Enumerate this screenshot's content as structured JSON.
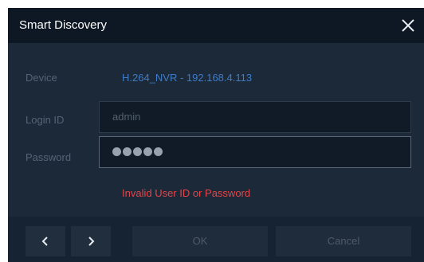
{
  "dialog": {
    "title": "Smart Discovery",
    "close_icon": "close-icon"
  },
  "device": {
    "label": "Device",
    "value": "H.264_NVR - 192.168.4.113"
  },
  "login": {
    "label": "Login ID",
    "value": "admin"
  },
  "password": {
    "label": "Password",
    "masked_length": 5
  },
  "error": {
    "message": "Invalid User ID or Password"
  },
  "footer": {
    "prev_icon": "chevron-left-icon",
    "next_icon": "chevron-right-icon",
    "ok_label": "OK",
    "cancel_label": "Cancel"
  },
  "colors": {
    "dialog_bg": "#1b2939",
    "titlebar_bg": "#0e1824",
    "device_value": "#3e7cc8",
    "error": "#e2454a"
  }
}
